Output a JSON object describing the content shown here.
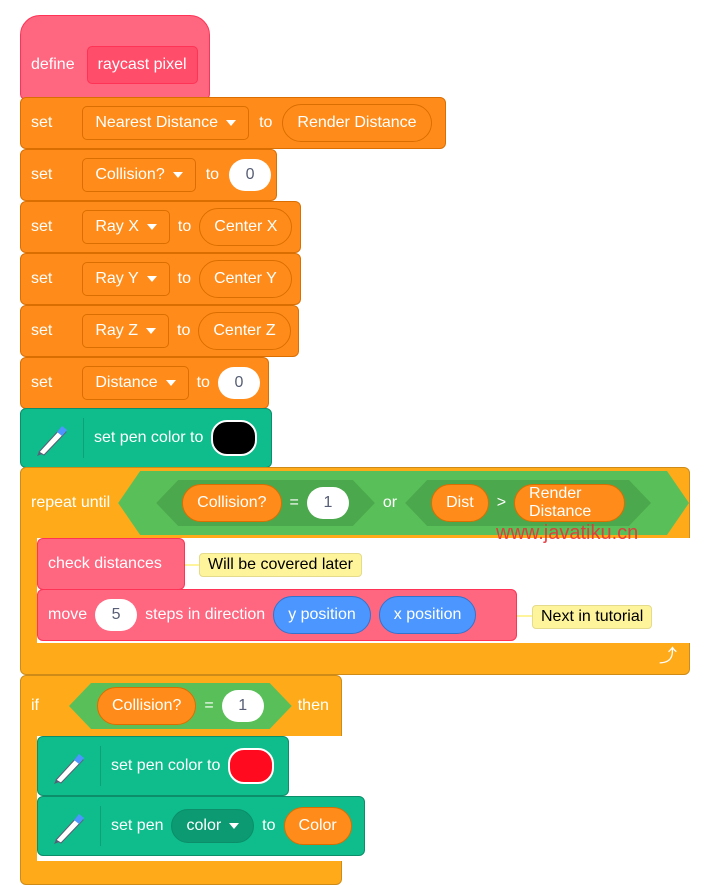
{
  "define_block": {
    "keyword": "define",
    "name": "raycast pixel"
  },
  "set_blocks": [
    {
      "keyword": "set",
      "variable": "Nearest Distance",
      "to": "to",
      "value": "Render Distance",
      "value_type": "reporter"
    },
    {
      "keyword": "set",
      "variable": "Collision?",
      "to": "to",
      "value": "0",
      "value_type": "number"
    },
    {
      "keyword": "set",
      "variable": "Ray X",
      "to": "to",
      "value": "Center X",
      "value_type": "reporter"
    },
    {
      "keyword": "set",
      "variable": "Ray Y",
      "to": "to",
      "value": "Center Y",
      "value_type": "reporter"
    },
    {
      "keyword": "set",
      "variable": "Ray Z",
      "to": "to",
      "value": "Center Z",
      "value_type": "reporter"
    },
    {
      "keyword": "set",
      "variable": "Distance",
      "to": "to",
      "value": "0",
      "value_type": "number"
    }
  ],
  "pen_color_1": {
    "label": "set pen color to",
    "color": "#000000"
  },
  "repeat_until": {
    "keyword": "repeat until",
    "cond_left": {
      "var": "Collision?",
      "op": "=",
      "value": "1"
    },
    "join": "or",
    "cond_right": {
      "var": "Dist",
      "op": ">",
      "value": "Render Distance"
    }
  },
  "check_distances": {
    "label": "check distances",
    "comment": "Will be covered later"
  },
  "move_block": {
    "move": "move",
    "steps": "5",
    "label": "steps in direction",
    "arg1": "y position",
    "arg2": "x position",
    "comment": "Next in tutorial"
  },
  "if_block": {
    "keyword": "if",
    "var": "Collision?",
    "op": "=",
    "value": "1",
    "then": "then"
  },
  "pen_color_2": {
    "label": "set pen color to",
    "color": "#ff0a1e"
  },
  "set_pen_param": {
    "label": "set pen",
    "param": "color",
    "to": "to",
    "value": "Color"
  },
  "watermark": "www.javatiku.cn"
}
